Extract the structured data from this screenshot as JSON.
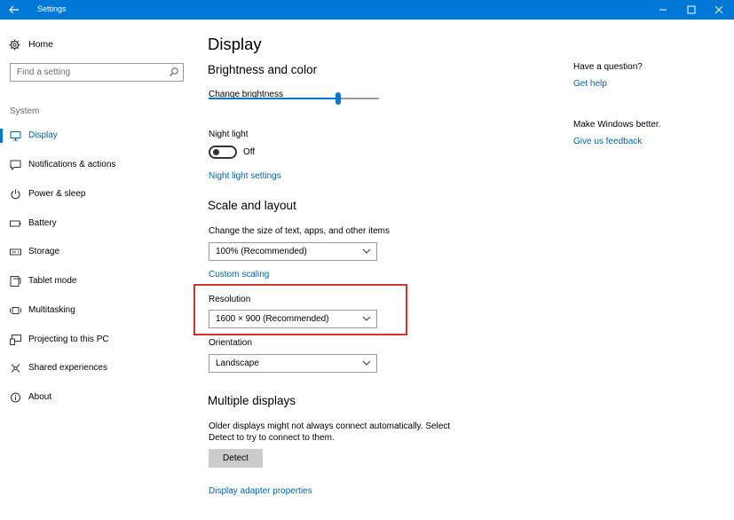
{
  "window": {
    "title": "Settings"
  },
  "sidebar": {
    "home_label": "Home",
    "search_placeholder": "Find a setting",
    "section_label": "System",
    "items": [
      {
        "label": "Display",
        "icon": "monitor-icon",
        "active": true
      },
      {
        "label": "Notifications & actions",
        "icon": "notifications-icon"
      },
      {
        "label": "Power & sleep",
        "icon": "power-icon"
      },
      {
        "label": "Battery",
        "icon": "battery-icon"
      },
      {
        "label": "Storage",
        "icon": "storage-icon"
      },
      {
        "label": "Tablet mode",
        "icon": "tablet-icon"
      },
      {
        "label": "Multitasking",
        "icon": "multitasking-icon"
      },
      {
        "label": "Projecting to this PC",
        "icon": "projecting-icon"
      },
      {
        "label": "Shared experiences",
        "icon": "shared-experiences-icon"
      },
      {
        "label": "About",
        "icon": "info-icon"
      }
    ]
  },
  "main": {
    "title": "Display",
    "brightness": {
      "heading": "Brightness and color",
      "slider_label": "Change brightness",
      "slider_value": 0.76,
      "night_light_label": "Night light",
      "night_light_state": "Off",
      "night_light_settings_link": "Night light settings"
    },
    "scale": {
      "heading": "Scale and layout",
      "size_label": "Change the size of text, apps, and other items",
      "size_value": "100% (Recommended)",
      "custom_scaling_link": "Custom scaling",
      "resolution_label": "Resolution",
      "resolution_value": "1600 × 900 (Recommended)",
      "orientation_label": "Orientation",
      "orientation_value": "Landscape"
    },
    "multiple": {
      "heading": "Multiple displays",
      "description_line1": "Older displays might not always connect automatically. Select",
      "description_line2": "Detect to try to connect to them.",
      "detect_button": "Detect",
      "adapter_link": "Display adapter properties"
    }
  },
  "right": {
    "question": "Have a question?",
    "help_link": "Get help",
    "better": "Make Windows better.",
    "feedback_link": "Give us feedback"
  },
  "colors": {
    "accent": "#0078d7",
    "link": "#0063b1",
    "highlight_box": "#d0342c"
  }
}
